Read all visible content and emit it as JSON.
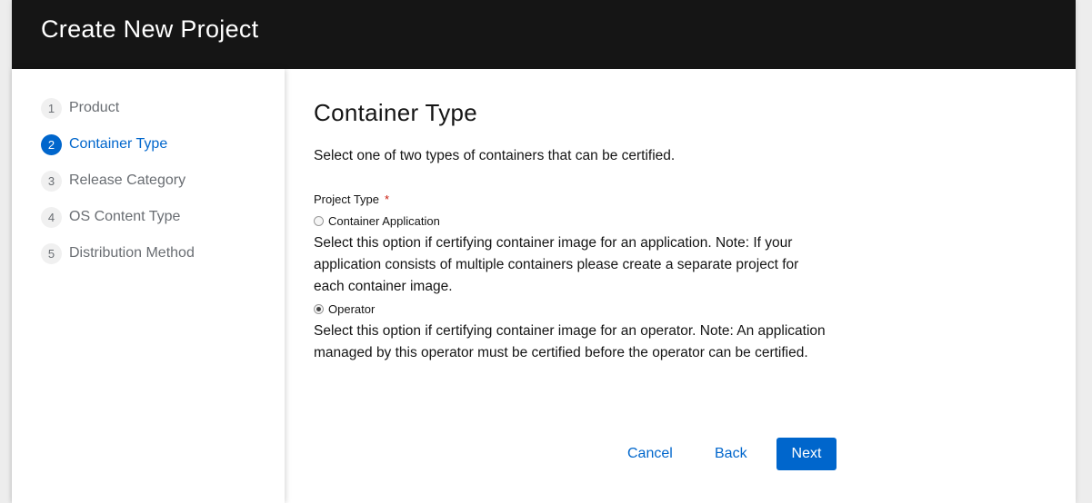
{
  "modal": {
    "title": "Create New Project"
  },
  "steps": [
    {
      "number": "1",
      "label": "Product",
      "current": false
    },
    {
      "number": "2",
      "label": "Container Type",
      "current": true
    },
    {
      "number": "3",
      "label": "Release Category",
      "current": false
    },
    {
      "number": "4",
      "label": "OS Content Type",
      "current": false
    },
    {
      "number": "5",
      "label": "Distribution Method",
      "current": false
    }
  ],
  "content": {
    "title": "Container Type",
    "description": "Select one of two types of containers that can be certified.",
    "field_label": "Project Type",
    "required_marker": "*",
    "options": [
      {
        "label": "Container Application",
        "checked": false,
        "description": "Select this option if certifying container image for an application. Note: If your application consists of multiple containers please create a separate project for each container image."
      },
      {
        "label": "Operator",
        "checked": true,
        "description": "Select this option if certifying container image for an operator. Note: An application managed by this operator must be certified before the operator can be certified."
      }
    ]
  },
  "buttons": {
    "cancel": "Cancel",
    "back": "Back",
    "next": "Next"
  },
  "colors": {
    "header_bg": "#151515",
    "accent": "#0066cc",
    "required": "#c9190b"
  }
}
